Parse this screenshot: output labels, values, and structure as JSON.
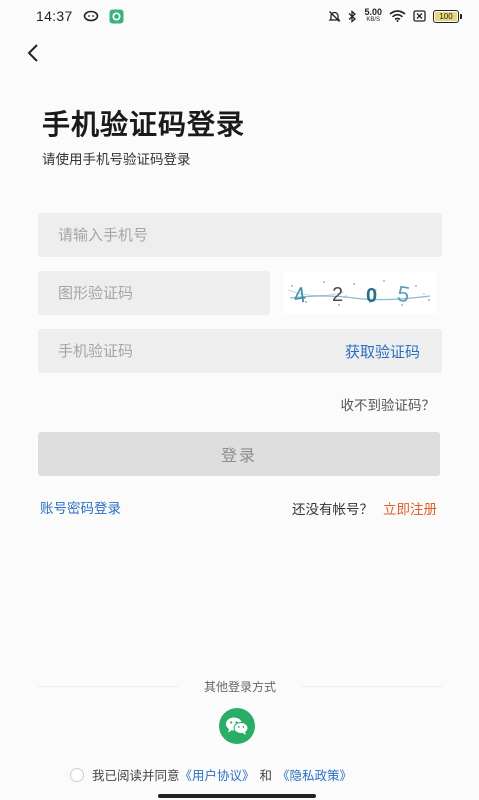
{
  "status_bar": {
    "time": "14:37",
    "net_speed_value": "5.00",
    "net_speed_unit": "KB/S",
    "battery": "100"
  },
  "header": {
    "title": "手机验证码登录",
    "subtitle": "请使用手机号验证码登录"
  },
  "form": {
    "phone_placeholder": "请输入手机号",
    "captcha_placeholder": "图形验证码",
    "captcha_text": "4205",
    "sms_placeholder": "手机验证码",
    "get_code_label": "获取验证码",
    "no_code_label": "收不到验证码？",
    "login_label": "登录"
  },
  "links": {
    "password_login": "账号密码登录",
    "no_account": "还没有帐号？",
    "register": "立即注册"
  },
  "other_login": {
    "label": "其他登录方式"
  },
  "agreement": {
    "prefix": "我已阅读并同意",
    "user_agreement": "《用户协议》",
    "and": "和",
    "privacy_policy": "《隐私政策》"
  },
  "colors": {
    "link_blue": "#2b6fc4",
    "register_orange": "#e0602b",
    "wechat_green": "#2aae67"
  },
  "icons": [
    "back-arrow-icon",
    "wechat-icon",
    "wifi-icon",
    "bluetooth-icon",
    "battery-icon"
  ]
}
